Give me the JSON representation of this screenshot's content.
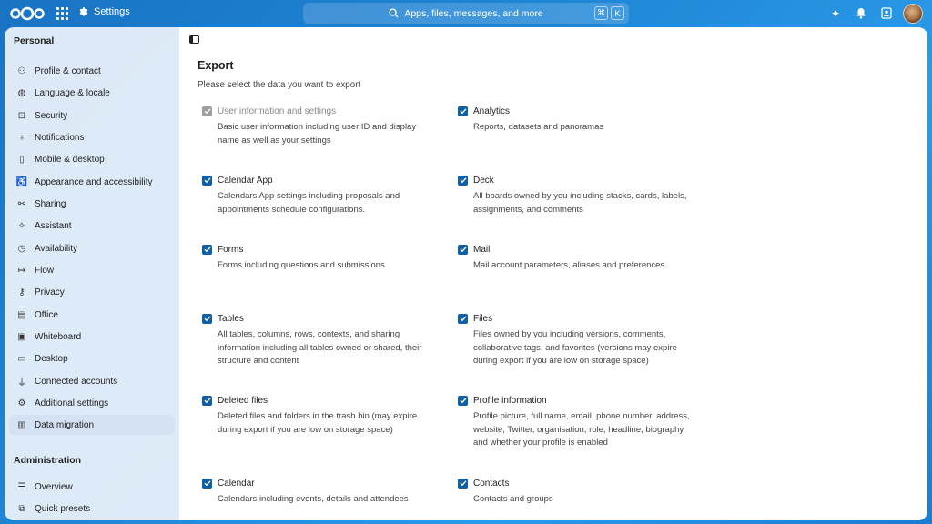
{
  "topbar": {
    "app_name": "Settings",
    "search_placeholder": "Apps, files, messages, and more",
    "shortcut_key_1": "⌘",
    "shortcut_key_2": "K"
  },
  "sidebar": {
    "personal_title": "Personal",
    "personal_items": [
      {
        "label": "Profile & contact",
        "icon": "user-icon"
      },
      {
        "label": "Language & locale",
        "icon": "globe-icon"
      },
      {
        "label": "Security",
        "icon": "lock-icon"
      },
      {
        "label": "Notifications",
        "icon": "bell-icon"
      },
      {
        "label": "Mobile & desktop",
        "icon": "phone-icon"
      },
      {
        "label": "Appearance and accessibility",
        "icon": "accessibility-icon"
      },
      {
        "label": "Sharing",
        "icon": "share-icon"
      },
      {
        "label": "Assistant",
        "icon": "sparkle-icon"
      },
      {
        "label": "Availability",
        "icon": "clock-icon"
      },
      {
        "label": "Flow",
        "icon": "flow-icon"
      },
      {
        "label": "Privacy",
        "icon": "key-icon"
      },
      {
        "label": "Office",
        "icon": "document-icon"
      },
      {
        "label": "Whiteboard",
        "icon": "whiteboard-icon"
      },
      {
        "label": "Desktop",
        "icon": "monitor-icon"
      },
      {
        "label": "Connected accounts",
        "icon": "plug-icon"
      },
      {
        "label": "Additional settings",
        "icon": "gear-icon"
      },
      {
        "label": "Data migration",
        "icon": "migration-icon",
        "active": true
      }
    ],
    "admin_title": "Administration",
    "admin_items": [
      {
        "label": "Overview",
        "icon": "sliders-icon"
      },
      {
        "label": "Quick presets",
        "icon": "presets-icon"
      }
    ]
  },
  "main": {
    "title": "Export",
    "subtitle": "Please select the data you want to export",
    "options_left": [
      {
        "label": "User information and settings",
        "desc": "Basic user information including user ID and display name as well as your settings",
        "checked": true,
        "disabled": true
      },
      {
        "label": "Calendar App",
        "desc": "Calendars App settings including proposals and appointments schedule configurations.",
        "checked": true
      },
      {
        "label": "Forms",
        "desc": "Forms including questions and submissions",
        "checked": true
      },
      {
        "label": "Tables",
        "desc": "All tables, columns, rows, contexts, and sharing information including all tables owned or shared, their structure and content",
        "checked": true
      },
      {
        "label": "Deleted files",
        "desc": "Deleted files and folders in the trash bin (may expire during export if you are low on storage space)",
        "checked": true
      },
      {
        "label": "Calendar",
        "desc": "Calendars including events, details and attendees",
        "checked": true
      }
    ],
    "options_right": [
      {
        "label": "Analytics",
        "desc": "Reports, datasets and panoramas",
        "checked": true
      },
      {
        "label": "Deck",
        "desc": "All boards owned by you including stacks, cards, labels, assignments, and comments",
        "checked": true
      },
      {
        "label": "Mail",
        "desc": "Mail account parameters, aliases and preferences",
        "checked": true
      },
      {
        "label": "Files",
        "desc": "Files owned by you including versions, comments, collaborative tags, and favorites (versions may expire during export if you are low on storage space)",
        "checked": true
      },
      {
        "label": "Profile information",
        "desc": "Profile picture, full name, email, phone number, address, website, Twitter, organisation, role, headline, biography, and whether your profile is enabled",
        "checked": true
      },
      {
        "label": "Contacts",
        "desc": "Contacts and groups",
        "checked": true
      }
    ]
  }
}
